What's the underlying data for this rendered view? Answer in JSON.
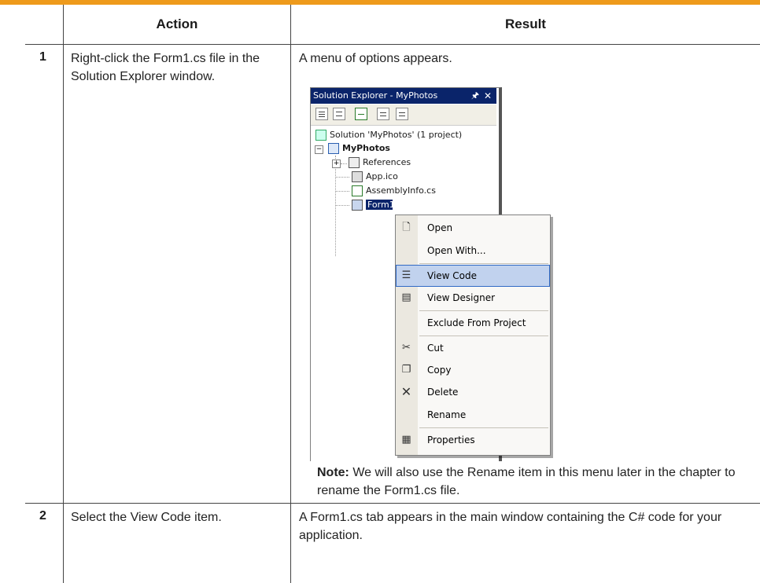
{
  "table": {
    "headers": {
      "action": "Action",
      "result": "Result"
    },
    "rows": [
      {
        "step": "1",
        "action": "Right-click the Form1.cs file in the Solution Explorer window.",
        "result": "A menu of options appears.",
        "note_label": "Note:",
        "note_text": " We will also use the Rename item in this menu later in the chapter to rename the Form1.cs file."
      },
      {
        "step": "2",
        "action": "Select the View Code item.",
        "result": "A Form1.cs tab appears in the main window containing the C# code for your application."
      }
    ]
  },
  "solution_explorer": {
    "title": "Solution Explorer - MyPhotos",
    "pin_icon": "pin-icon",
    "close_icon": "close-icon",
    "tree": {
      "solution": "Solution 'MyPhotos' (1 project)",
      "project": "MyPhotos",
      "references": "References",
      "app_ico": "App.ico",
      "assembly_info": "AssemblyInfo.cs",
      "form1": "Form1.cs"
    }
  },
  "context_menu": {
    "items": [
      {
        "label": "Open",
        "icon": "open-file-icon"
      },
      {
        "label": "Open With...",
        "icon": ""
      },
      {
        "label": "View Code",
        "icon": "view-code-icon",
        "highlighted": true
      },
      {
        "label": "View Designer",
        "icon": "view-designer-icon"
      },
      {
        "label": "Exclude From Project",
        "icon": ""
      },
      {
        "label": "Cut",
        "icon": "scissors-icon"
      },
      {
        "label": "Copy",
        "icon": "copy-icon"
      },
      {
        "label": "Delete",
        "icon": "delete-x-icon"
      },
      {
        "label": "Rename",
        "icon": ""
      },
      {
        "label": "Properties",
        "icon": "properties-icon"
      }
    ]
  },
  "colors": {
    "accent_bar": "#ee9a1b",
    "title_bar": "#0a246a",
    "menu_highlight": "#c1d2ee"
  }
}
